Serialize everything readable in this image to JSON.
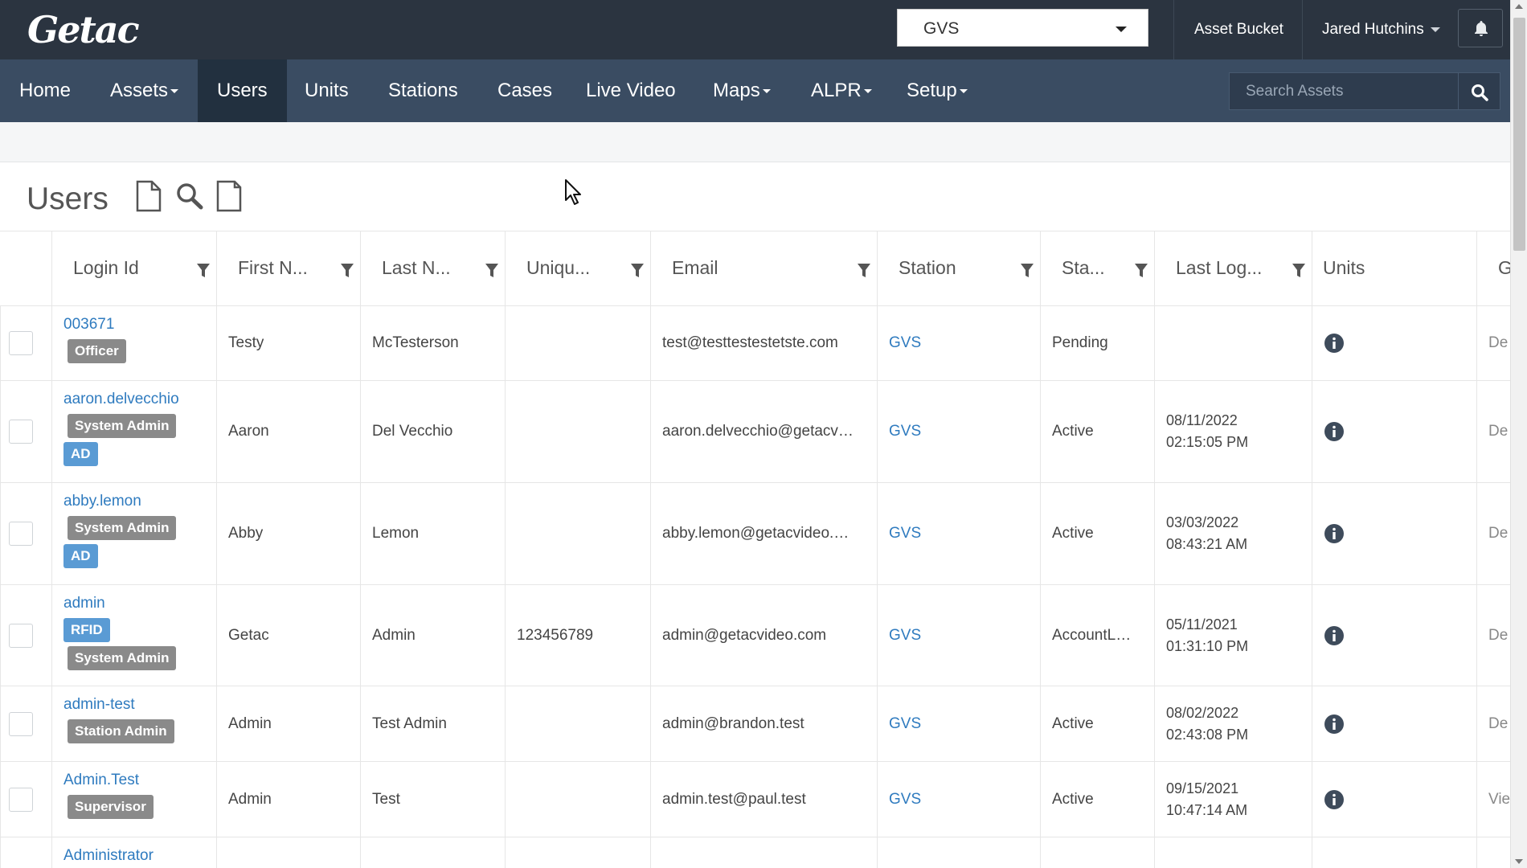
{
  "brand": {
    "logo": "Getac"
  },
  "topbar": {
    "agency_select": "GVS",
    "asset_bucket": "Asset Bucket",
    "user_name": "Jared Hutchins"
  },
  "nav": {
    "items": [
      {
        "label": "Home",
        "dropdown": false
      },
      {
        "label": "Assets",
        "dropdown": true
      },
      {
        "label": "Users",
        "dropdown": false,
        "active": true
      },
      {
        "label": "Units",
        "dropdown": false
      },
      {
        "label": "Stations",
        "dropdown": false
      },
      {
        "label": "Cases",
        "dropdown": false
      },
      {
        "label": "Live Video",
        "dropdown": false
      },
      {
        "label": "Maps",
        "dropdown": true
      },
      {
        "label": "ALPR",
        "dropdown": true
      },
      {
        "label": "Setup",
        "dropdown": true
      }
    ],
    "search_placeholder": "Search Assets"
  },
  "page": {
    "title": "Users"
  },
  "table": {
    "columns": [
      "Login Id",
      "First N...",
      "Last N...",
      "Uniqu...",
      "Email",
      "Station",
      "Sta...",
      "Last Log...",
      "Units",
      "G"
    ],
    "rows": [
      {
        "login": "003671",
        "badges": [
          {
            "text": "Officer",
            "color": "grey"
          }
        ],
        "first": "Testy",
        "last": "McTesterson",
        "unique": "",
        "email": "test@testtestestetste.com",
        "station": "GVS",
        "status": "Pending",
        "last_login_date": "",
        "last_login_time": "",
        "extra": "De"
      },
      {
        "login": "aaron.delvecchio",
        "badges": [
          {
            "text": "System Admin",
            "color": "grey"
          },
          {
            "text": "AD",
            "color": "blue"
          }
        ],
        "first": "Aaron",
        "last": "Del Vecchio",
        "unique": "",
        "email": "aaron.delvecchio@getacv…",
        "station": "GVS",
        "status": "Active",
        "last_login_date": "08/11/2022",
        "last_login_time": "02:15:05 PM",
        "extra": "De"
      },
      {
        "login": "abby.lemon",
        "badges": [
          {
            "text": "System Admin",
            "color": "grey"
          },
          {
            "text": "AD",
            "color": "blue"
          }
        ],
        "first": "Abby",
        "last": "Lemon",
        "unique": "",
        "email": "abby.lemon@getacvideo.…",
        "station": "GVS",
        "status": "Active",
        "last_login_date": "03/03/2022",
        "last_login_time": "08:43:21 AM",
        "extra": "De"
      },
      {
        "login": "admin",
        "badges": [
          {
            "text": "RFID",
            "color": "blue"
          },
          {
            "text": "System Admin",
            "color": "grey"
          }
        ],
        "first": "Getac",
        "last": "Admin",
        "unique": "123456789",
        "email": "admin@getacvideo.com",
        "station": "GVS",
        "status": "AccountL…",
        "last_login_date": "05/11/2021",
        "last_login_time": "01:31:10 PM",
        "extra": "De"
      },
      {
        "login": "admin-test",
        "badges": [
          {
            "text": "Station Admin",
            "color": "grey"
          }
        ],
        "first": "Admin",
        "last": "Test Admin",
        "unique": "",
        "email": "admin@brandon.test",
        "station": "GVS",
        "status": "Active",
        "last_login_date": "08/02/2022",
        "last_login_time": "02:43:08 PM",
        "extra": "De"
      },
      {
        "login": "Admin.Test",
        "badges": [
          {
            "text": "Supervisor",
            "color": "grey"
          }
        ],
        "first": "Admin",
        "last": "Test",
        "unique": "",
        "email": "admin.test@paul.test",
        "station": "GVS",
        "status": "Active",
        "last_login_date": "09/15/2021",
        "last_login_time": "10:47:14 AM",
        "extra": "Vie"
      },
      {
        "login": "Administrator",
        "badges": [],
        "first": "",
        "last": "",
        "unique": "",
        "email": "",
        "station": "",
        "status": "",
        "last_login_date": "",
        "last_login_time": "",
        "extra": ""
      }
    ]
  },
  "colors": {
    "topbar": "#2b3440",
    "navbar": "#3a4c62",
    "nav_active": "#22303f",
    "link": "#2f7bbf",
    "badge_grey": "#8a8a8a",
    "badge_blue": "#5a9bd4",
    "info_icon": "#3e4b5b"
  }
}
